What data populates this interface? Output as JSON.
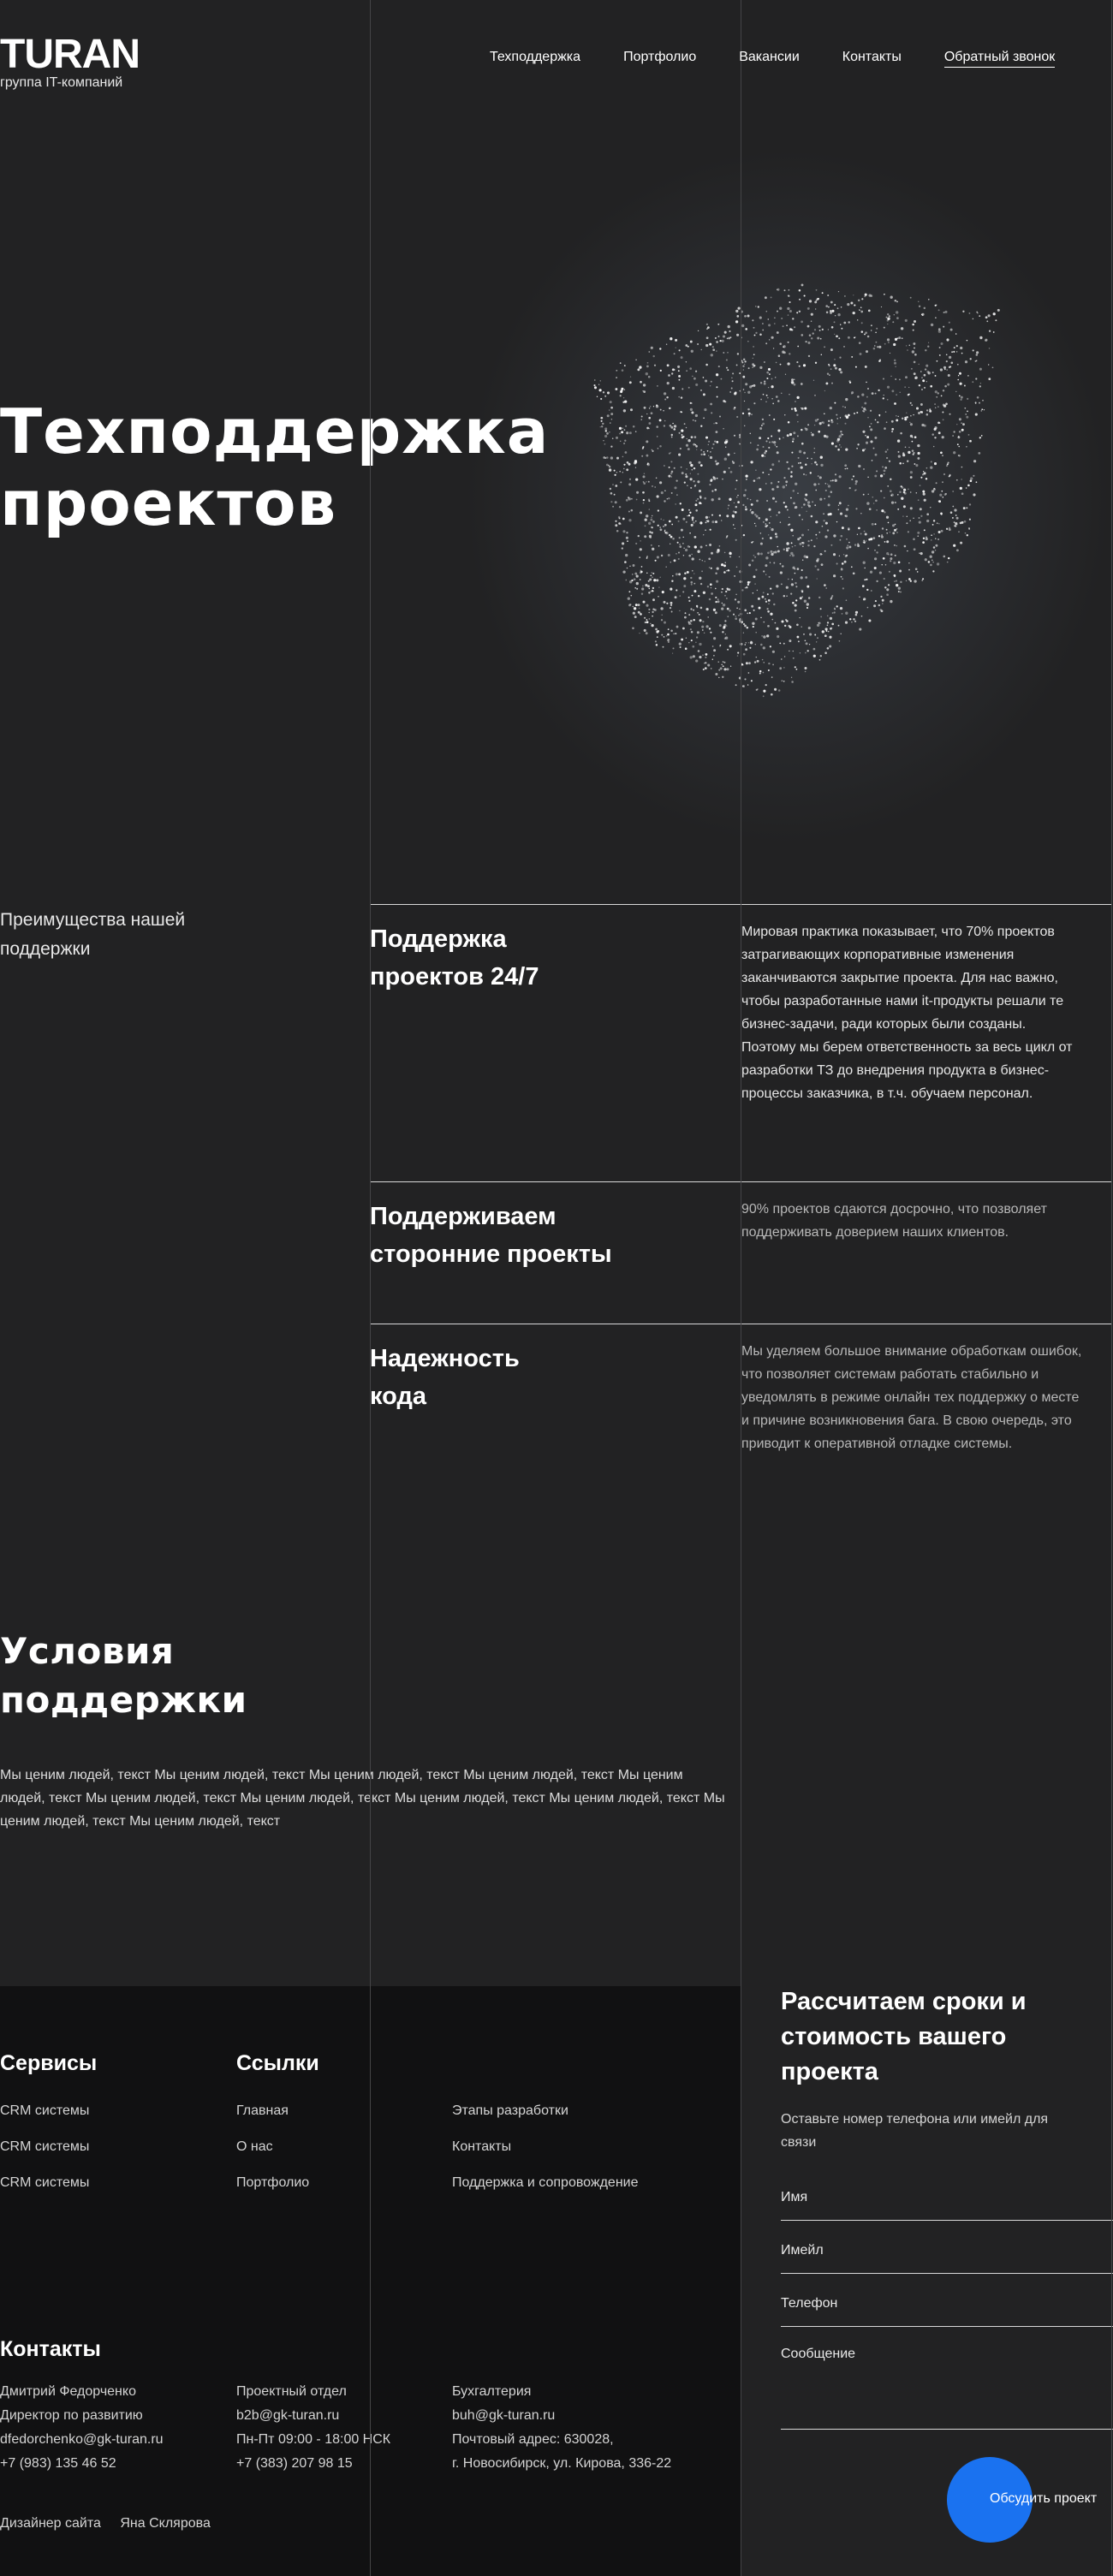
{
  "header": {
    "logo_name": "TURAN",
    "logo_sub": "группа IT-компаний",
    "nav": [
      "Техподдержка",
      "Портфолио",
      "Вакансии",
      "Контакты",
      "Обратный звонок"
    ]
  },
  "hero": {
    "title_line1": "Техподдержка",
    "title_line2": "проектов"
  },
  "advantages": {
    "label": "Преимущества нашей поддержки",
    "items": [
      {
        "title": "Поддержка проектов 24/7",
        "text": "Мировая практика показывает,  что 70% проектов затрагивающих корпоративные изменения заканчиваются закрытие проекта. Для нас важно, чтобы разработанные нами it-продукты решали те бизнес-задачи, ради которых были созданы. Поэтому мы берем ответственность за весь цикл от разработки ТЗ до внедрения продукта в бизнес-процессы заказчика, в т.ч. обучаем персонал."
      },
      {
        "title": "Поддерживаем сторонние проекты",
        "text": "90% проектов сдаются досрочно, что позволяет поддерживать доверием наших клиентов."
      },
      {
        "title": "Надежность кода",
        "text": "Мы уделяем большое внимание обработкам ошибок, что позволяет системам работать стабильно и уведомлять в режиме онлайн тех поддержку о месте и причине возникновения бага. В свою очередь, это приводит к оперативной отладке системы."
      }
    ]
  },
  "conditions": {
    "title_line1": "Условия",
    "title_line2": "поддержки",
    "text": "Мы ценим людей, текст Мы ценим людей, текст Мы ценим людей, текст Мы ценим людей, текст Мы ценим людей, текст Мы ценим людей, текст Мы ценим людей, текст Мы ценим людей, текст Мы ценим людей, текст Мы ценим людей, текст Мы ценим людей, текст"
  },
  "footer": {
    "services_title": "Сервисы",
    "services": [
      "CRM системы",
      "CRM системы",
      "CRM системы"
    ],
    "links_title": "Ссылки",
    "links_col1": [
      "Главная",
      "О нас",
      "Портфолио"
    ],
    "links_col2": [
      "Этапы разработки",
      "Контакты",
      "Поддержка и сопровождение"
    ],
    "contacts_title": "Контакты",
    "contact1": {
      "name": "Дмитрий Федорченко",
      "role": "Директор по развитию",
      "email": "dfedorchenko@gk-turan.ru",
      "phone": "+7 (983) 135 46 52"
    },
    "contact2": {
      "name": "Проектный отдел",
      "email": "b2b@gk-turan.ru",
      "hours": "Пн-Пт 09:00 - 18:00 НСК",
      "phone": "+7 (383) 207 98 15"
    },
    "contact3": {
      "name": "Бухгалтерия",
      "email": "buh@gk-turan.ru",
      "address1": "Почтовый адрес: 630028,",
      "address2": "г. Новосибирск, ул. Кирова, 336-22"
    },
    "designer_label": "Дизайнер сайта",
    "designer_name": "Яна Склярова"
  },
  "form": {
    "title": "Рассчитаем сроки и стоимость вашего проекта",
    "subtitle": "Оставьте номер телефона или имейл для связи",
    "name_placeholder": "Имя",
    "email_placeholder": "Имейл",
    "phone_placeholder": "Телефон",
    "message_placeholder": "Сообщение",
    "submit_label": "Обсудить проект",
    "accent_color": "#1a72f0"
  }
}
